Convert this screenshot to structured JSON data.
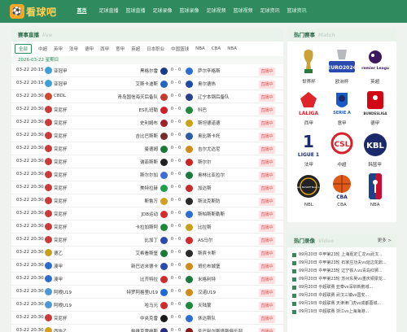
{
  "brand": {
    "name": "看球吧"
  },
  "nav": [
    "首页",
    "足球直播",
    "篮球直播",
    "足球录像",
    "篮球录像",
    "足球视频",
    "篮球视频",
    "足球资讯",
    "篮球资讯"
  ],
  "live_panel": {
    "title": "赛事直播",
    "ghost": "live",
    "date": "2026-03-22 星期日",
    "filters": [
      "全部",
      "中超",
      "英甲",
      "法甲",
      "德甲",
      "西甲",
      "意甲",
      "英超",
      "日本职业",
      "中国篮球",
      "NBA",
      "CBA",
      "NBA"
    ]
  },
  "matches": [
    {
      "time": "03-22 20:15",
      "league": "亚冠甲",
      "home": "黑格尔雷",
      "score": "0 - 0",
      "away": "萨尔辛格斯",
      "status": "直播中",
      "lc": "#3aa0d8",
      "hc": "#1b3c8c",
      "ac": "#2a6ed1"
    },
    {
      "time": "03-22 20:15",
      "league": "亚冠甲",
      "home": "艾斯卡迪斯",
      "score": "0 - 0",
      "away": "奥尔德热",
      "status": "直播中",
      "lc": "#3aa0d8",
      "hc": "#2266c4",
      "ac": "#1f4aa6"
    },
    {
      "time": "03-22 20:30",
      "league": "CBDL",
      "home": "青岛国信海天后备队",
      "score": "0 - 0",
      "away": "辽宁本钢后备队",
      "status": "直播中",
      "lc": "#d14a2c",
      "hc": "#c63a2c",
      "ac": "#2a3f8f"
    },
    {
      "time": "03-22 20:30",
      "league": "突尼杯",
      "home": "ES扎班勒",
      "score": "0 - 0",
      "away": "科巴",
      "status": "直播中",
      "lc": "#cc3a3a",
      "hc": "#d11f2a",
      "ac": "#1f8a3a"
    },
    {
      "time": "03-22 20:30",
      "league": "突尼杯",
      "home": "史利姆布",
      "score": "0 - 0",
      "away": "斯坦德诺德",
      "status": "直播中",
      "lc": "#cc3a3a",
      "hc": "#a21f2a",
      "ac": "#c9a21a"
    },
    {
      "time": "03-22 20:30",
      "league": "突尼杯",
      "home": "吉比巴斯斯",
      "score": "0 - 0",
      "away": "奥比斯卡托",
      "status": "直播中",
      "lc": "#cc3a3a",
      "hc": "#7a2a2a",
      "ac": "#2a5ba8"
    },
    {
      "time": "03-22 20:30",
      "league": "突尼杯",
      "home": "曼德姆",
      "score": "0 - 0",
      "away": "吉尔尤达尼",
      "status": "直播中",
      "lc": "#cc3a3a",
      "hc": "#1a7a3a",
      "ac": "#d08a1a"
    },
    {
      "time": "03-22 20:30",
      "league": "突尼杯",
      "home": "谢菲斯斯",
      "score": "0 - 0",
      "away": "斯尔尔",
      "status": "直播中",
      "lc": "#cc3a3a",
      "hc": "#222",
      "ac": "#c22"
    },
    {
      "time": "03-22 20:30",
      "league": "突尼杯",
      "home": "斯尔尔加",
      "score": "0 - 0",
      "away": "奥林比亚拉尔",
      "status": "直播中",
      "lc": "#cc3a3a",
      "hc": "#3a6ed8",
      "ac": "#1a7a3a"
    },
    {
      "time": "03-22 20:30",
      "league": "突尼杯",
      "home": "美特拉赫",
      "score": "0 - 0",
      "away": "加达斯",
      "status": "直播中",
      "lc": "#cc3a3a",
      "hc": "#1aa04a",
      "ac": "#c7282a"
    },
    {
      "time": "03-22 20:30",
      "league": "突尼杯",
      "home": "斯鲁万",
      "score": "0 - 0",
      "away": "斯法克斯防",
      "status": "直播中",
      "lc": "#cc3a3a",
      "hc": "#d0a01a",
      "ac": "#2a2a2a"
    },
    {
      "time": "03-22 20:30",
      "league": "突尼杯",
      "home": "JDB运动",
      "score": "0 - 0",
      "away": "斯帕斯斯勒斯",
      "status": "直播中",
      "lc": "#cc3a3a",
      "hc": "#d82a2a",
      "ac": "#2a6ed1"
    },
    {
      "time": "03-22 20:30",
      "league": "突尼杯",
      "home": "卡拉加斯阿",
      "score": "0 - 0",
      "away": "比拉斯",
      "status": "直播中",
      "lc": "#cc3a3a",
      "hc": "#1a8a3a",
      "ac": "#c7a01a"
    },
    {
      "time": "03-22 20:30",
      "league": "突尼杯",
      "home": "比加丁",
      "score": "0 - 0",
      "away": "AS马尔",
      "status": "直播中",
      "lc": "#cc3a3a",
      "hc": "#2a4ab0",
      "ac": "#d02a2a"
    },
    {
      "time": "03-22 20:30",
      "league": "德乙",
      "home": "艾希看斯堡",
      "score": "0 - 0",
      "away": "斯宾卡斯",
      "status": "直播中",
      "lc": "#c7a01a",
      "hc": "#1a7a3a",
      "ac": "#2a2a2a"
    },
    {
      "time": "03-22 20:30",
      "league": "澳甲",
      "home": "新巴达米德卡",
      "score": "0 - 0",
      "away": "哥伦布城堡",
      "status": "直播中",
      "lc": "#2a6ed1",
      "hc": "#2a4ab0",
      "ac": "#d08a1a"
    },
    {
      "time": "03-22 20:30",
      "league": "澳甲",
      "home": "比齐特拉",
      "score": "0 - 0",
      "away": "米格利特",
      "status": "直播中",
      "lc": "#2a6ed1",
      "hc": "#d02a2a",
      "ac": "#1a7a3a"
    },
    {
      "time": "03-22 20:30",
      "league": "阿根U19",
      "home": "特罗阿格里U19",
      "score": "0 - 0",
      "away": "汉诺U19",
      "status": "直播中",
      "lc": "#4a9ad8",
      "hc": "#1a6ad8",
      "ac": "#d08a1a"
    },
    {
      "time": "03-22 20:30",
      "league": "阿根U19",
      "home": "哈马元",
      "score": "0 - 0",
      "away": "天陆蒙",
      "status": "直播中",
      "lc": "#4a9ad8",
      "hc": "#d02a2a",
      "ac": "#1a8a3a"
    },
    {
      "time": "03-22 20:30",
      "league": "突尼杯",
      "home": "中央克雷",
      "score": "0 - 0",
      "away": "休达斯队",
      "status": "直播中",
      "lc": "#cc3a3a",
      "hc": "#1a1a1a",
      "ac": "#2a6ed1"
    },
    {
      "time": "03-22 20:30",
      "league": "西协乙",
      "home": "帕维克雷维斯",
      "score": "0 - 0",
      "away": "圣巴利尔斯塔斯俱乐部",
      "status": "直播中",
      "lc": "#d8a01a",
      "hc": "#2a2a8a",
      "ac": "#8a1a1a"
    }
  ],
  "hot_leagues": {
    "title": "热门赛事",
    "ghost": "Match",
    "items": [
      {
        "label": "世界杯",
        "icon": "world-cup-icon",
        "color": "#8a6d2a"
      },
      {
        "label": "欧洲杯",
        "icon": "euro-2024-icon",
        "color": "#2a4ab0"
      },
      {
        "label": "英超",
        "icon": "premier-league-icon",
        "color": "#3d185c"
      },
      {
        "label": "西甲",
        "icon": "laliga-icon",
        "color": "#e0242c"
      },
      {
        "label": "意甲",
        "icon": "serie-a-icon",
        "color": "#1a5ac7"
      },
      {
        "label": "德甲",
        "icon": "bundesliga-icon",
        "color": "#d20515"
      },
      {
        "label": "法甲",
        "icon": "ligue1-icon",
        "color": "#1a2a6b"
      },
      {
        "label": "中超",
        "icon": "csl-icon",
        "color": "#d8202a"
      },
      {
        "label": "韩篮甲",
        "icon": "kbl-icon",
        "color": "#1a2a6b"
      },
      {
        "label": "NBL",
        "icon": "nbl-icon",
        "color": "#222222"
      },
      {
        "label": "CBA",
        "icon": "cba-icon",
        "color": "#e05a1a"
      },
      {
        "label": "NBA",
        "icon": "nba-icon",
        "color": "#1d428a"
      }
    ],
    "logo_text": {
      "euro": "EURO2024",
      "premier": "Premier League",
      "laliga": "LALIGA",
      "seriea": "SERIE A",
      "bundes": "BUNDESLIGA",
      "ligue": "LIGUE 1",
      "csl": "CSL",
      "kbl": "KBL",
      "nbl": "NATIONAL BASKETBALL LEAGUE",
      "cba": "CBA"
    }
  },
  "videos": {
    "title": "热门录像",
    "ghost": "Video",
    "more": "更多 >",
    "items": [
      "09月20日 中甲第23轮 上海嘉定汇龙vs武汉...",
      "09月20日 中甲第23轮 石家庄功夫vs延边龙鼎...",
      "09月20日 中甲第23轮 辽宁铁人vs青岛红狮...",
      "09月20日 中甲第23轮 苏州东吴vs重庆铜梁龙...",
      "09月20日 中超联赛 亚泰vs深圳新鹏城...",
      "09月20日 中超联赛 武汉三镇vs国安...",
      "09月19日 中超联赛 天津津门虎vs成都蓉城...",
      "09月19日 中超联赛 浙江vs上海海港..."
    ]
  }
}
